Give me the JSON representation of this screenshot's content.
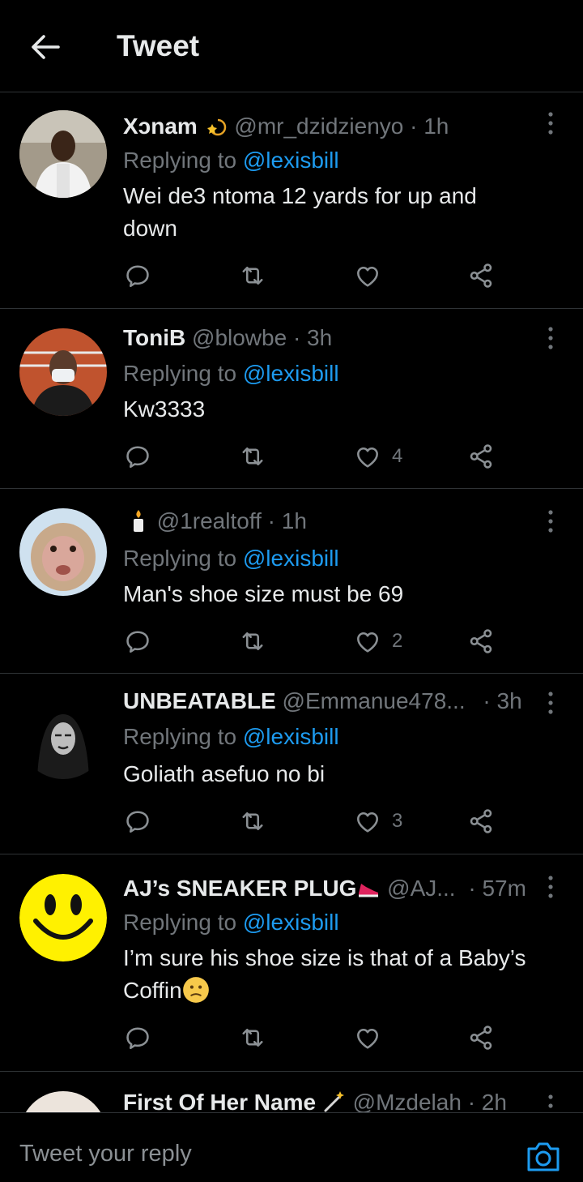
{
  "header": {
    "title": "Tweet"
  },
  "replies": [
    {
      "name": "Xɔnam",
      "handle": "@mr_dzidzienyo",
      "time": "· 1h",
      "replying_prefix": "Replying to ",
      "replying_to": "@lexisbill",
      "text": "Wei de3 ntoma 12 yards for up and down",
      "likes": ""
    },
    {
      "name": "ToniB",
      "handle": "@blowbe",
      "time": "· 3h",
      "replying_prefix": "Replying to ",
      "replying_to": "@lexisbill",
      "text": "Kw3333",
      "likes": "4"
    },
    {
      "name": "",
      "handle": "@1realtoff",
      "time": "· 1h",
      "replying_prefix": "Replying to ",
      "replying_to": "@lexisbill",
      "text": "Man's shoe size must be 69",
      "likes": "2"
    },
    {
      "name": "UNBEATABLE",
      "handle": "@Emmanue478...",
      "time": "· 3h",
      "replying_prefix": "Replying to ",
      "replying_to": "@lexisbill",
      "text": "Goliath asefuo no bi",
      "likes": "3"
    },
    {
      "name": "AJ’s SNEAKER PLUG",
      "handle": "@AJ...",
      "time": "· 57m",
      "replying_prefix": "Replying to ",
      "replying_to": "@lexisbill",
      "text": "I’m sure his shoe size is that of a Baby’s Coffin",
      "likes": ""
    },
    {
      "name": "First Of Her Name",
      "handle": "@Mzdelah",
      "time": "· 2h"
    }
  ],
  "composer": {
    "placeholder": "Tweet your reply"
  },
  "colors": {
    "background": "#000000",
    "link": "#1d9bf0",
    "secondary_text": "#71767b",
    "divider": "#2f3336"
  },
  "icons": [
    "back-arrow-icon",
    "reply-icon",
    "retweet-icon",
    "like-icon",
    "share-icon",
    "more-options-icon",
    "camera-icon"
  ]
}
